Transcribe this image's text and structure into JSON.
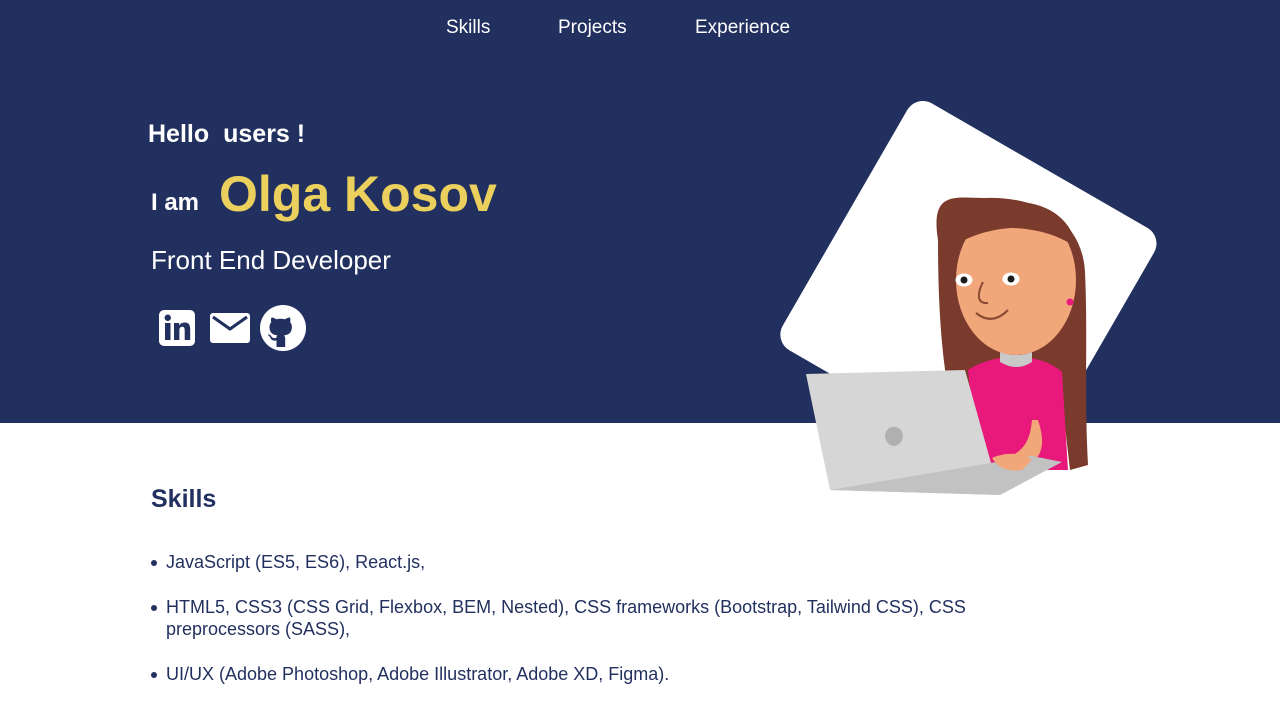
{
  "nav": {
    "items": [
      {
        "label": "Skills"
      },
      {
        "label": "Projects"
      },
      {
        "label": "Experience"
      }
    ]
  },
  "hero": {
    "greeting_hello": "Hello",
    "greeting_users": "users !",
    "i_am": "I am",
    "name": "Olga Kosov",
    "role": "Front End Developer",
    "social": [
      {
        "icon": "linkedin-icon"
      },
      {
        "icon": "mail-icon"
      },
      {
        "icon": "github-icon"
      }
    ]
  },
  "skills": {
    "title": "Skills",
    "items": [
      "JavaScript (ES5, ES6), React.js,",
      "HTML5, CSS3 (CSS Grid, Flexbox, BEM, Nested), CSS frameworks (Bootstrap, Tailwind CSS), CSS preprocessors (SASS),",
      "UI/UX (Adobe Photoshop, Adobe Illustrator, Adobe XD, Figma)."
    ]
  },
  "colors": {
    "hero_bg": "#22305f",
    "accent": "#ecd05d",
    "text_dark": "#22305f"
  }
}
